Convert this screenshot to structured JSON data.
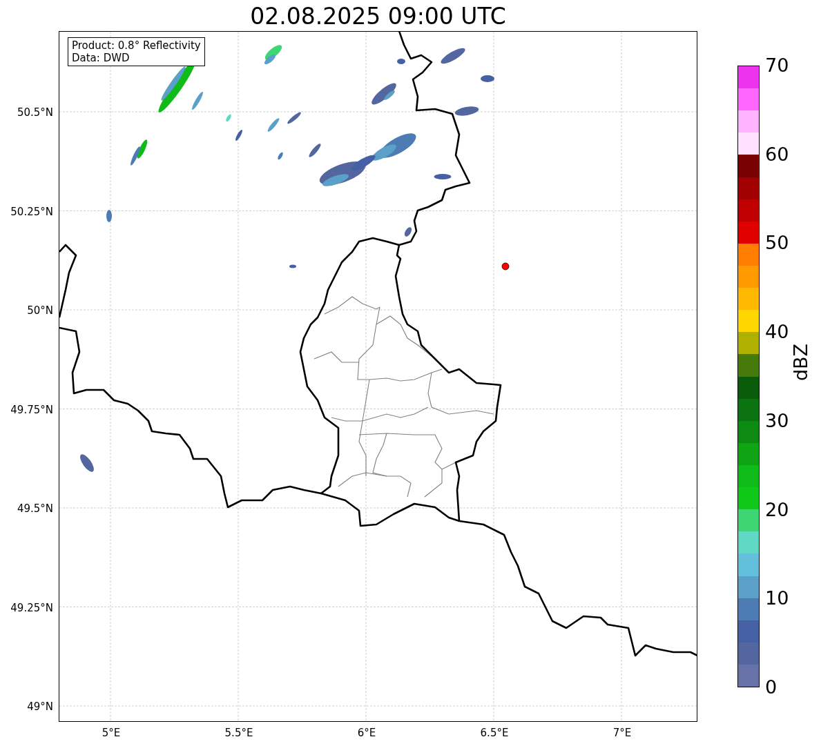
{
  "title": "02.08.2025 09:00 UTC",
  "legend": [
    "Product: 0.8° Reflectivity",
    "Data: DWD"
  ],
  "map": {
    "xticks": [
      "5°E",
      "5.5°E",
      "6°E",
      "6.5°E",
      "7°E"
    ],
    "yticks": [
      "50.5°N",
      "50.25°N",
      "50°N",
      "49.75°N",
      "49.5°N",
      "49.25°N",
      "49°N"
    ]
  },
  "colorbar": {
    "label": "dBZ",
    "ticks": [
      "70",
      "60",
      "50",
      "40",
      "30",
      "20",
      "10",
      "0"
    ],
    "bins": [
      {
        "color": "#ee33ee"
      },
      {
        "color": "#ff66ff"
      },
      {
        "color": "#ffb3ff"
      },
      {
        "color": "#ffe0ff"
      },
      {
        "color": "#780000"
      },
      {
        "color": "#a00000"
      },
      {
        "color": "#c00000"
      },
      {
        "color": "#e00000"
      },
      {
        "color": "#ff7d00"
      },
      {
        "color": "#ff9a00"
      },
      {
        "color": "#ffb900"
      },
      {
        "color": "#ffd700"
      },
      {
        "color": "#b0b000"
      },
      {
        "color": "#467a0a"
      },
      {
        "color": "#085c0a"
      },
      {
        "color": "#0b7410"
      },
      {
        "color": "#0c8a12"
      },
      {
        "color": "#0ea414"
      },
      {
        "color": "#0fbb18"
      },
      {
        "color": "#10c818"
      },
      {
        "color": "#3dd672"
      },
      {
        "color": "#5fd8c4"
      },
      {
        "color": "#63c0dc"
      },
      {
        "color": "#5aa0c8"
      },
      {
        "color": "#4c7cb3"
      },
      {
        "color": "#4560a4"
      },
      {
        "color": "#5466a0"
      },
      {
        "color": "#6672a8"
      }
    ]
  }
}
